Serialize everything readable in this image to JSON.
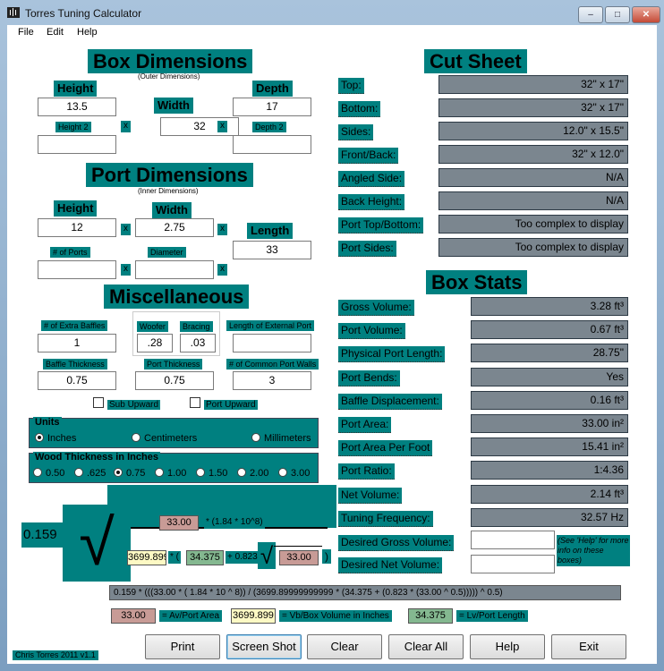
{
  "window": {
    "title": "Torres Tuning Calculator"
  },
  "menu": {
    "file": "File",
    "edit": "Edit",
    "help": "Help"
  },
  "box": {
    "title": "Box Dimensions",
    "subtitle": "(Outer Dimensions)",
    "height_label": "Height",
    "height": "13.5",
    "width_label": "Width",
    "width": "32",
    "depth_label": "Depth",
    "depth": "17",
    "height2_label": "Height 2",
    "height2": "",
    "depth2_label": "Depth 2",
    "depth2": "",
    "x": "x"
  },
  "port": {
    "title": "Port Dimensions",
    "subtitle": "(Inner Dimensions)",
    "height_label": "Height",
    "height": "12",
    "width_label": "Width",
    "width": "2.75",
    "length_label": "Length",
    "length": "33",
    "num_ports_label": "# of Ports",
    "num_ports": "",
    "diameter_label": "Diameter",
    "diameter": ""
  },
  "misc": {
    "title": "Miscellaneous",
    "extra_baffles_label": "# of Extra Baffles",
    "extra_baffles": "1",
    "woofer_label": "Woofer",
    "woofer": ".28",
    "bracing_label": "Bracing",
    "bracing": ".03",
    "ext_port_label": "Length of External Port",
    "ext_port": "",
    "baffle_thick_label": "Baffle Thickness",
    "baffle_thick": "0.75",
    "port_thick_label": "Port Thickness",
    "port_thick": "0.75",
    "common_walls_label": "# of Common Port Walls",
    "common_walls": "3",
    "sub_upward": "Sub Upward",
    "port_upward": "Port Upward"
  },
  "units": {
    "title": "Units",
    "options": [
      "Inches",
      "Centimeters",
      "Millimeters"
    ],
    "selected": "Inches"
  },
  "wood": {
    "title": "Wood Thickness in Inches",
    "options": [
      "0.50",
      ".625",
      "0.75",
      "1.00",
      "1.50",
      "2.00",
      "3.00"
    ],
    "selected": "0.75"
  },
  "cut_sheet": {
    "title": "Cut Sheet",
    "rows": [
      {
        "label": "Top:",
        "value": "32\" x 17\""
      },
      {
        "label": "Bottom:",
        "value": "32\" x 17\""
      },
      {
        "label": "Sides:",
        "value": "12.0\" x 15.5\""
      },
      {
        "label": "Front/Back:",
        "value": "32\" x 12.0\""
      },
      {
        "label": "Angled Side:",
        "value": "N/A"
      },
      {
        "label": "Back Height:",
        "value": "N/A"
      },
      {
        "label": "Port Top/Bottom:",
        "value": "Too complex to display"
      },
      {
        "label": "Port Sides:",
        "value": "Too complex to display"
      }
    ]
  },
  "stats": {
    "title": "Box Stats",
    "rows": [
      {
        "label": "Gross Volume:",
        "value": "3.28 ft³"
      },
      {
        "label": "Port Volume:",
        "value": "0.67 ft³"
      },
      {
        "label": "Physical Port Length:",
        "value": "28.75\""
      },
      {
        "label": "Port Bends:",
        "value": "Yes"
      },
      {
        "label": "Baffle Displacement:",
        "value": "0.16 ft³"
      },
      {
        "label": "Port Area:",
        "value": "33.00 in²"
      },
      {
        "label": "Port Area Per Foot",
        "value": "15.41 in²"
      },
      {
        "label": "Port Ratio:",
        "value": "1:4.36"
      },
      {
        "label": "Net Volume:",
        "value": "2.14 ft³"
      },
      {
        "label": "Tuning Frequency:",
        "value": "32.57 Hz"
      }
    ],
    "desired_gross_label": "Desired Gross Volume:",
    "desired_gross": "",
    "desired_net_label": "Desired Net Volume:",
    "desired_net": "",
    "help_note": "(See 'Help' for more info on these boxes)"
  },
  "formula": {
    "coef": "0.159",
    "av": "33.00",
    "const": "* (1.84 * 10^8)",
    "vb": "3699.899",
    "star_paren": "* (",
    "lv": "34.375",
    "plus": "+ 0.823",
    "av_sqrt": "33.00",
    "close": ")",
    "full": "0.159 * (((33.00 * ( 1.84 * 10 ^ 8)) / (3699.89999999999 * (34.375 + (0.823 * (33.00 ^ 0.5))))) ^ 0.5)",
    "legend_av_value": "33.00",
    "legend_av_text": "= Av/Port Area",
    "legend_vb_value": "3699.899",
    "legend_vb_text": "= Vb/Box Volume in Inches",
    "legend_lv_value": "34.375",
    "legend_lv_text": "= Lv/Port Length"
  },
  "footer": {
    "credit": "Chris Torres 2011 v1.1"
  },
  "buttons": {
    "print": "Print",
    "screenshot": "Screen Shot",
    "clear": "Clear",
    "clear_all": "Clear All",
    "help": "Help",
    "exit": "Exit"
  },
  "colors": {
    "teal": "#008080",
    "readout": "#7b868f",
    "av": "#c89b96",
    "vb": "#fdf9c4",
    "lv": "#84b890"
  }
}
